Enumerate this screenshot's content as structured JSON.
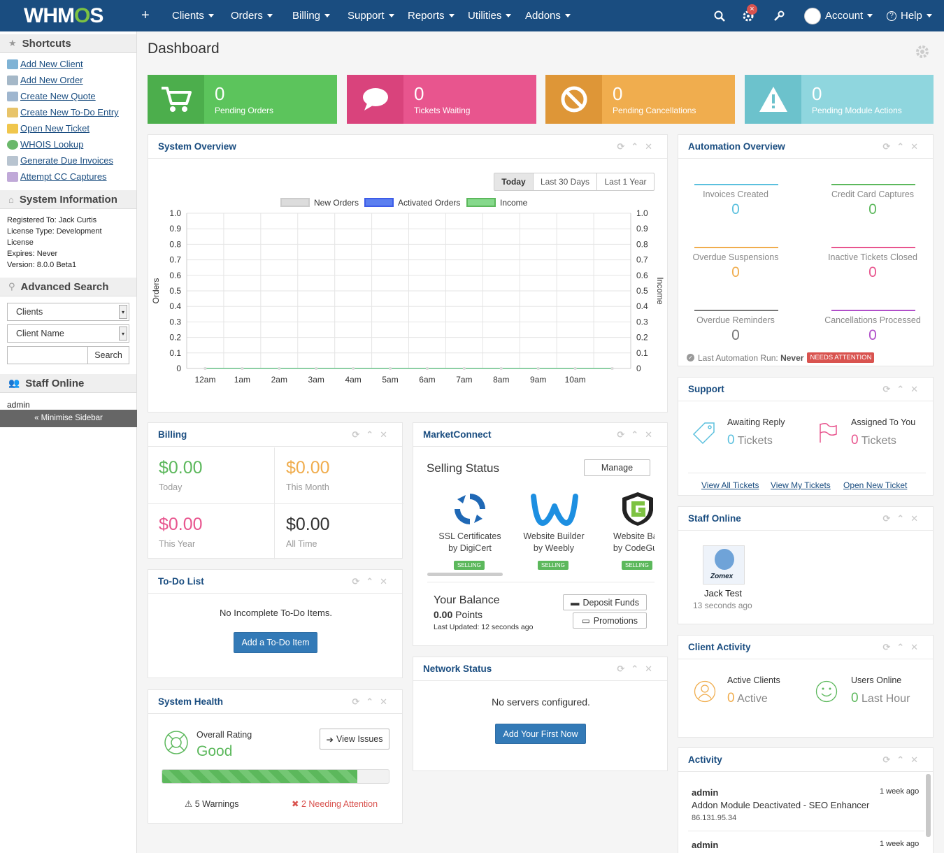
{
  "topbar": {
    "logo": "WHM",
    "logo_o": "O",
    "logo_s": "S",
    "nav": [
      "Clients",
      "Orders",
      "Billing",
      "Support",
      "Reports",
      "Utilities",
      "Addons"
    ],
    "account": "Account",
    "help": "Help",
    "notif_count": "×"
  },
  "sidebar": {
    "shortcuts_title": "Shortcuts",
    "shortcuts": [
      "Add New Client",
      "Add New Order",
      "Create New Quote",
      "Create New To-Do Entry",
      "Open New Ticket",
      "WHOIS Lookup",
      "Generate Due Invoices",
      "Attempt CC Captures"
    ],
    "sysinfo_title": "System Information",
    "registered": "Registered To: Jack Curtis",
    "license": "License Type: Development License",
    "expires": "Expires: Never",
    "version": "Version: 8.0.0 Beta1",
    "search_title": "Advanced Search",
    "search_type": "Clients",
    "search_field": "Client Name",
    "search_btn": "Search",
    "staff_title": "Staff Online",
    "staff_user": "admin",
    "minimise": "« Minimise Sidebar"
  },
  "page_title": "Dashboard",
  "stats": [
    {
      "value": "0",
      "label": "Pending Orders"
    },
    {
      "value": "0",
      "label": "Tickets Waiting"
    },
    {
      "value": "0",
      "label": "Pending Cancellations"
    },
    {
      "value": "0",
      "label": "Pending Module Actions"
    }
  ],
  "system_overview": {
    "title": "System Overview",
    "ranges": [
      "Today",
      "Last 30 Days",
      "Last 1 Year"
    ]
  },
  "chart_data": {
    "type": "line",
    "legend": [
      "New Orders",
      "Activated Orders",
      "Income"
    ],
    "legend_colors": [
      "#dcdcdc",
      "#5b7ff0",
      "#86d98c"
    ],
    "ylabel_left": "Orders",
    "ylabel_right": "Income",
    "ylim": [
      0,
      1
    ],
    "yticks": [
      "0",
      "0.1",
      "0.2",
      "0.3",
      "0.4",
      "0.5",
      "0.6",
      "0.7",
      "0.8",
      "0.9",
      "1.0"
    ],
    "categories": [
      "12am",
      "1am",
      "2am",
      "3am",
      "4am",
      "5am",
      "6am",
      "7am",
      "8am",
      "9am",
      "10am"
    ],
    "series": [
      {
        "name": "New Orders",
        "values": [
          0,
          0,
          0,
          0,
          0,
          0,
          0,
          0,
          0,
          0,
          0,
          0
        ]
      },
      {
        "name": "Activated Orders",
        "values": [
          0,
          0,
          0,
          0,
          0,
          0,
          0,
          0,
          0,
          0,
          0,
          0
        ]
      },
      {
        "name": "Income",
        "values": [
          0,
          0,
          0,
          0,
          0,
          0,
          0,
          0,
          0,
          0,
          0,
          0
        ]
      }
    ]
  },
  "automation": {
    "title": "Automation Overview",
    "items": [
      {
        "label": "Invoices Created",
        "value": "0",
        "color": "#5bc0de"
      },
      {
        "label": "Credit Card Captures",
        "value": "0",
        "color": "#5cb85c"
      },
      {
        "label": "Overdue Suspensions",
        "value": "0",
        "color": "#f0ad4e"
      },
      {
        "label": "Inactive Tickets Closed",
        "value": "0",
        "color": "#e8558e"
      },
      {
        "label": "Overdue Reminders",
        "value": "0",
        "color": "#777777"
      },
      {
        "label": "Cancellations Processed",
        "value": "0",
        "color": "#b04fc9"
      }
    ],
    "last_run": "Last Automation Run:",
    "last_run_value": "Never",
    "needs": "NEEDS ATTENTION"
  },
  "support": {
    "title": "Support",
    "awaiting": "Awaiting Reply",
    "awaiting_val": "0",
    "assigned": "Assigned To You",
    "assigned_val": "0",
    "tickets_word": "Tickets",
    "links": [
      "View All Tickets",
      "View My Tickets",
      "Open New Ticket"
    ]
  },
  "staff_online": {
    "title": "Staff Online",
    "name": "Jack Test",
    "time": "13 seconds ago",
    "avatar_text": "Zomex"
  },
  "client_activity": {
    "title": "Client Activity",
    "active_label": "Active Clients",
    "active_val": "0",
    "active_word": "Active",
    "users_label": "Users Online",
    "users_val": "0",
    "users_word": "Last Hour"
  },
  "activity": {
    "title": "Activity",
    "items": [
      {
        "user": "admin",
        "time": "1 week ago",
        "text": "Addon Module Deactivated - SEO Enhancer",
        "ip": "86.131.95.34"
      },
      {
        "user": "admin",
        "time": "1 week ago",
        "text": "",
        "ip": ""
      }
    ]
  },
  "billing": {
    "title": "Billing",
    "items": [
      {
        "value": "$0.00",
        "label": "Today",
        "color": "#5cb85c"
      },
      {
        "value": "$0.00",
        "label": "This Month",
        "color": "#f0ad4e"
      },
      {
        "value": "$0.00",
        "label": "This Year",
        "color": "#e8558e"
      },
      {
        "value": "$0.00",
        "label": "All Time",
        "color": "#333333"
      }
    ]
  },
  "todo": {
    "title": "To-Do List",
    "empty": "No Incomplete To-Do Items.",
    "add": "Add a To-Do Item"
  },
  "health": {
    "title": "System Health",
    "overall": "Overall Rating",
    "rating": "Good",
    "view": "View Issues",
    "progress": 0.86,
    "warnings": "5 Warnings",
    "attention": "2 Needing Attention"
  },
  "market": {
    "title": "MarketConnect",
    "selling": "Selling Status",
    "manage": "Manage",
    "products": [
      {
        "line1": "SSL Certificates",
        "line2": "by DigiCert",
        "badge": "SELLING"
      },
      {
        "line1": "Website Builder",
        "line2": "by Weebly",
        "badge": "SELLING"
      },
      {
        "line1": "Website Bac",
        "line2": "by CodeGua",
        "badge": "SELLING"
      }
    ],
    "balance": "Your Balance",
    "points_val": "0.00",
    "points": "Points",
    "updated": "Last Updated: 12 seconds ago",
    "deposit": "Deposit Funds",
    "promotions": "Promotions"
  },
  "network": {
    "title": "Network Status",
    "empty": "No servers configured.",
    "add": "Add Your First Now"
  }
}
